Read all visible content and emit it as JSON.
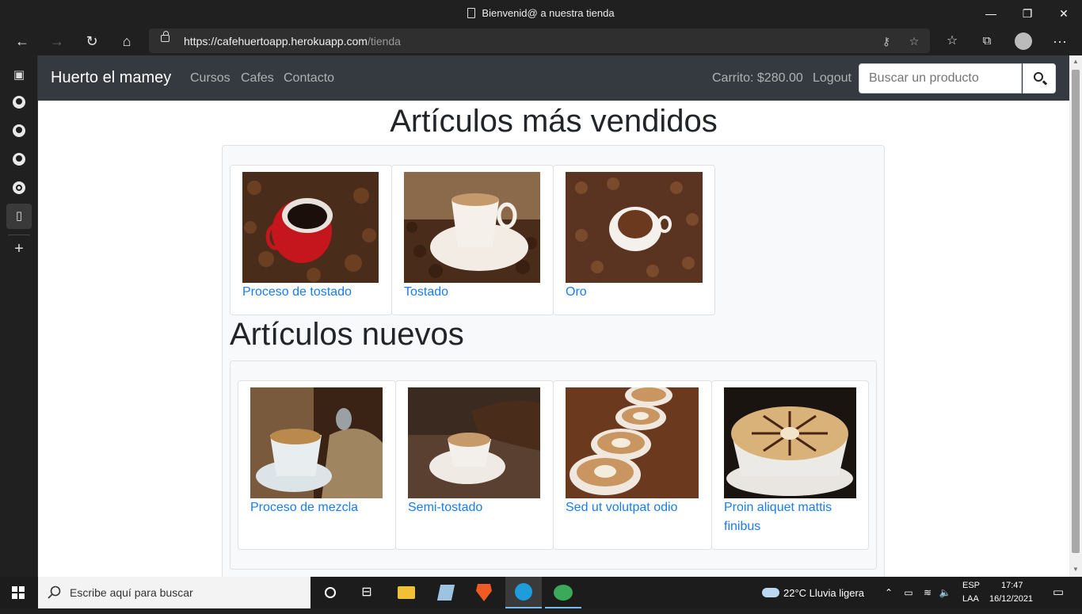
{
  "window": {
    "title": "Bienvenid@ a nuestra tienda",
    "minimize": "—",
    "maximize": "❐",
    "close": "✕"
  },
  "browser": {
    "url_host": "https://cafehuertoapp.herokuapp.com",
    "url_path": "/tienda",
    "back": "←",
    "forward": "→",
    "refresh": "↻",
    "home": "⌂",
    "more": "···"
  },
  "nav": {
    "brand": "Huerto el mamey",
    "links": [
      "Cursos",
      "Cafes",
      "Contacto"
    ],
    "cart": "Carrito: $280.00",
    "logout": "Logout",
    "search_placeholder": "Buscar un producto"
  },
  "sections": {
    "best_sellers": {
      "title": "Artículos más vendidos",
      "items": [
        "Proceso de tostado",
        "Tostado",
        "Oro"
      ]
    },
    "new_items": {
      "title": "Artículos nuevos",
      "items": [
        "Proceso de mezcla",
        "Semi-tostado",
        "Sed ut volutpat odio",
        "Proin aliquet mattis finibus"
      ]
    }
  },
  "taskbar": {
    "search_placeholder": "Escribe aquí para buscar",
    "weather": "22°C  Lluvia ligera",
    "lang_top": "ESP",
    "lang_bottom": "LAA",
    "time": "17:47",
    "date": "16/12/2021"
  }
}
